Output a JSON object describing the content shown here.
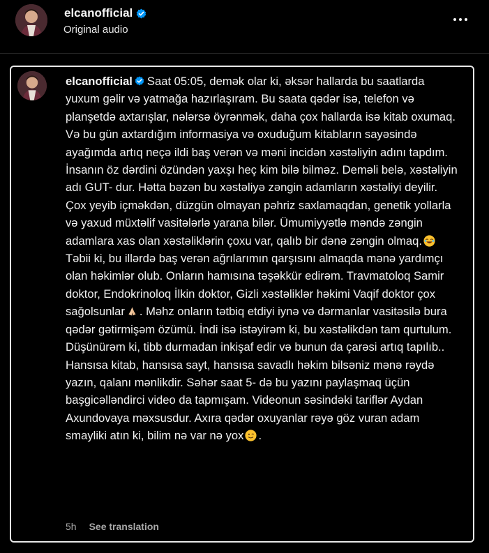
{
  "header": {
    "username": "elcanofficial",
    "subtitle": "Original audio"
  },
  "caption": {
    "username": "elcanofficial",
    "text_1": "Saat 05:05, demək olar ki, əksər hallarda bu saatlarda yuxum gəlir və yatmağa hazırlaşıram. Bu saata qədər isə, telefon və planşetdə axtarışlar, nələrsə öyrənmək, daha çox hallarda isə kitab oxumaq. Və bu gün axtardığım informasiya və oxuduğum kitabların sayəsində ayağımda artıq neçə ildi baş verən və məni incidən xəstəliyin adını tapdım. İnsanın öz dərdini özündən yaxşı heç kim bilə bilməz. Deməli belə, xəstəliyin adı GUT- dur. Hətta bəzən bu xəstəliyə zəngin adamların xəstəliyi deyilir. Çox yeyib içməkdən, düzgün olmayan pəhriz saxlamaqdan, genetik yollarla və yaxud müxtəlif vasitələrlə yarana bilər. Ümumiyyətlə məndə zəngin adamlara xas olan xəstəliklərin çoxu var, qalıb bir dənə zəngin olmaq.",
    "text_2": " Təbii ki, bu illərdə baş verən ağrılarımın qarşısını almaqda mənə yardımçı olan həkimlər olub. Onların hamısına təşəkkür edirəm. Travmatoloq Samir doktor, Endokrinoloq İlkin doktor, Gizli xəstəliklər həkimi Vaqif doktor çox sağolsunlar",
    "text_3": ". Məhz onların tətbiq etdiyi iynə və dərmanlar vasitəsilə bura qədər gətirmişəm özümü. İndi isə istəyirəm ki, bu xəstəlikdən tam qurtulum. Düşünürəm ki, tibb durmadan inkişaf edir və bunun da çarəsi artıq tapılıb.. Hansısa kitab, hansısa sayt, hansısa savadlı həkim bilsəniz mənə rəydə yazın, qalanı mənlikdir. Səhər saat 5- də bu yazını paylaşmaq üçün başgicəlləndirci video da tapmışam. Videonun səsindəki tariflər Aydan Axundovaya məxsusdur. Axıra qədər oxuyanlar rəyə göz vuran adam smayliki atın ki, bilim nə var nə yox",
    "text_4": "."
  },
  "meta": {
    "time": "5h",
    "translate": "See translation"
  },
  "colors": {
    "background": "#000000",
    "verified": "#0095f6",
    "muted": "#a8a8a8"
  },
  "icons": [
    "verified-badge-icon",
    "more-options-icon",
    "laughing-emoji-icon",
    "praying-hands-emoji-icon",
    "winking-emoji-icon"
  ]
}
